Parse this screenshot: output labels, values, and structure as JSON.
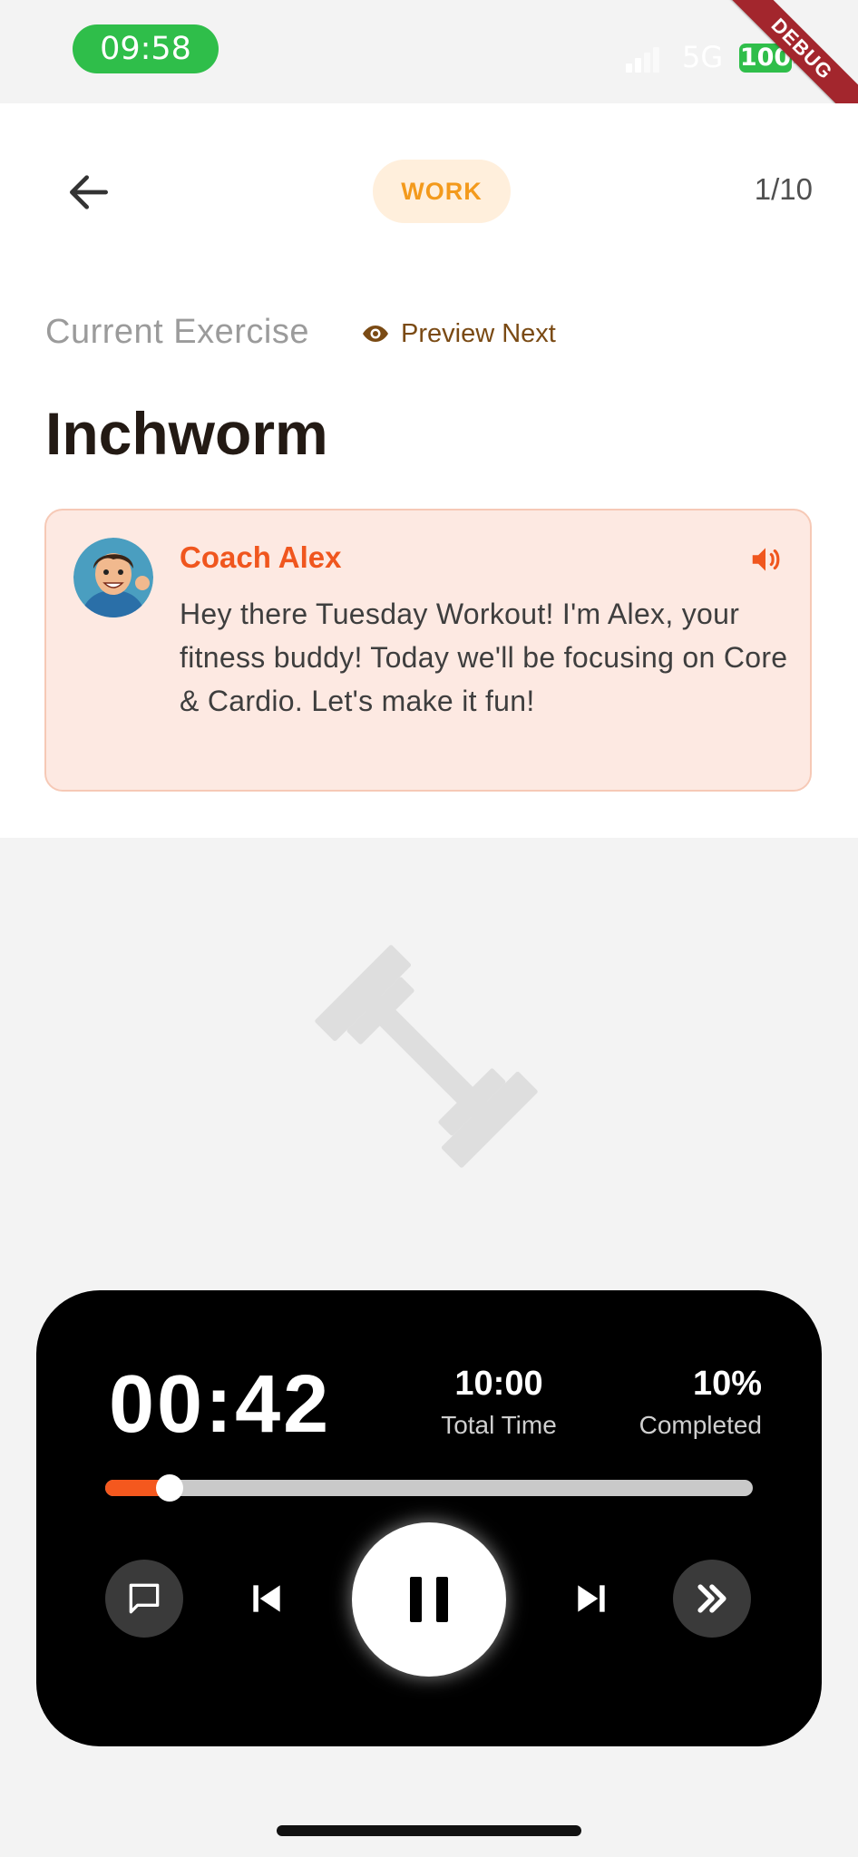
{
  "status_bar": {
    "time": "09:58",
    "network": "5G",
    "battery": "100",
    "debug_label": "DEBUG"
  },
  "header": {
    "phase_badge": "WORK",
    "counter": "1/10"
  },
  "exercise": {
    "section_label": "Current Exercise",
    "preview_next_label": "Preview Next",
    "name": "Inchworm"
  },
  "coach": {
    "name": "Coach Alex",
    "message": "Hey there Tuesday Workout! I'm Alex, your fitness buddy! Today we'll be focusing on Core & Cardio. Let's make it fun!"
  },
  "player": {
    "elapsed": "00:42",
    "total_time": "10:00",
    "total_time_label": "Total Time",
    "completed": "10%",
    "completed_label": "Completed",
    "progress_fraction": 0.1
  },
  "colors": {
    "accent_orange": "#f4581e",
    "badge_text": "#f39a1c",
    "badge_bg": "#ffefdc",
    "coach_card_bg": "#fde9e2",
    "status_green": "#2fbe4a"
  },
  "icons": {
    "back": "arrow-left-icon",
    "preview": "eye-icon",
    "speaker": "volume-icon",
    "hero": "dumbbell-icon",
    "chat": "chat-bubble-icon",
    "previous": "skip-previous-icon",
    "pause": "pause-icon",
    "next": "skip-next-icon",
    "skip": "double-chevron-right-icon"
  }
}
